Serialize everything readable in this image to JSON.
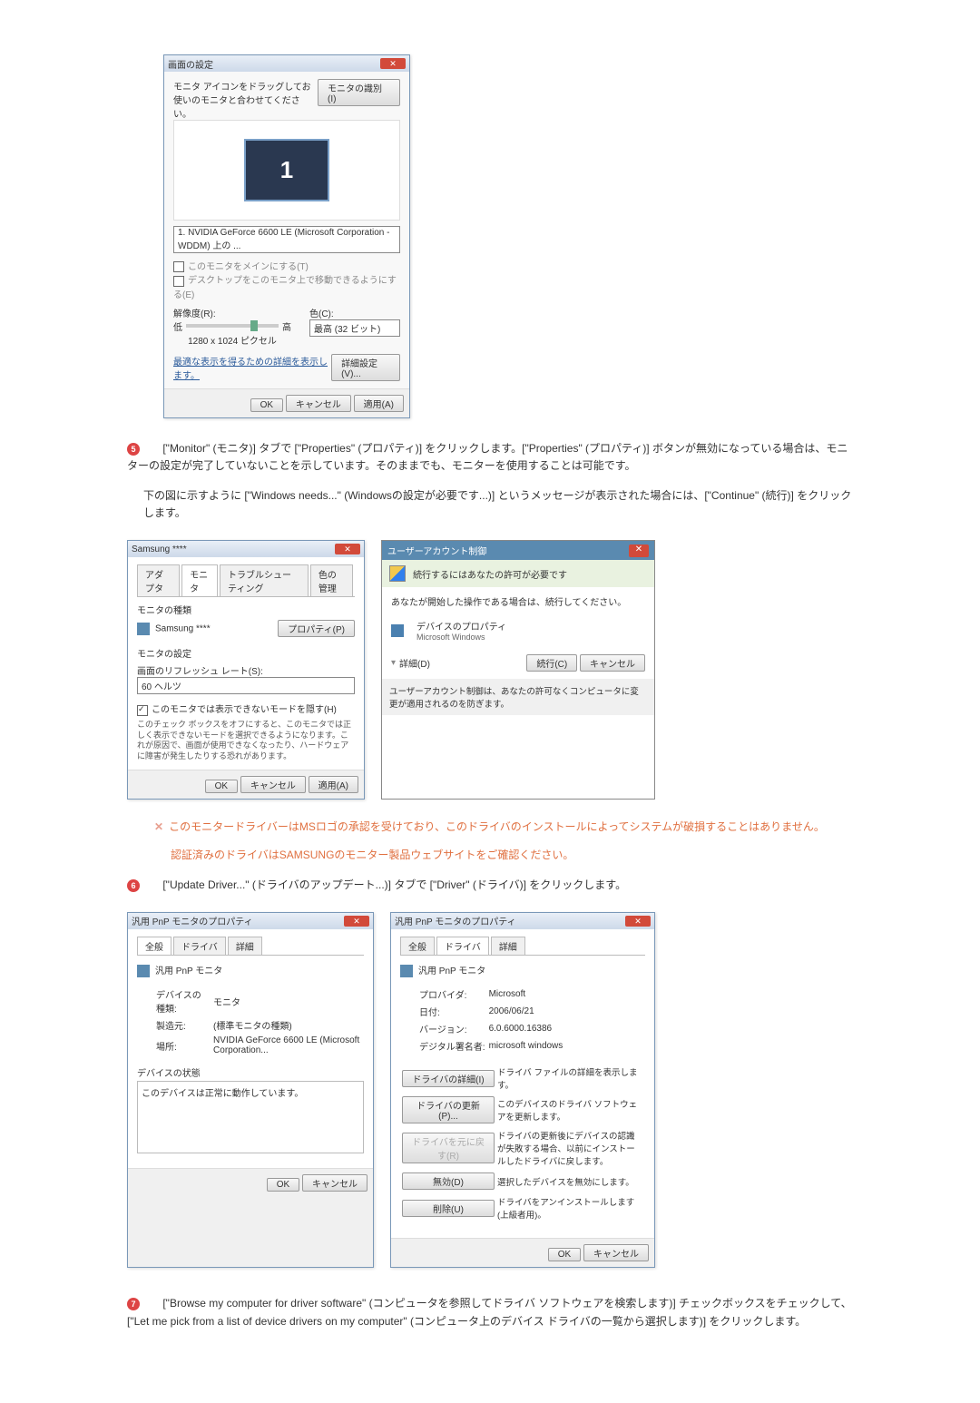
{
  "fig1": {
    "title": "画面の設定",
    "instruction": "モニタ アイコンをドラッグしてお使いのモニタと合わせてください。",
    "identify_btn": "モニタの識別(I)",
    "monitor_num": "1",
    "adapter_combo": "1. NVIDIA GeForce 6600 LE (Microsoft Corporation - WDDM) 上の ...",
    "chk_primary": "このモニタをメインにする(T)",
    "chk_extend": "デスクトップをこのモニタ上で移動できるようにする(E)",
    "resolution_label": "解像度(R):",
    "color_label": "色(C):",
    "slider_low": "低",
    "slider_high": "高",
    "resolution_value": "1280 x 1024 ピクセル",
    "color_combo": "最高 (32 ビット)",
    "adv_link": "最適な表示を得るための詳細を表示します。",
    "adv_btn": "詳細設定(V)...",
    "ok": "OK",
    "cancel": "キャンセル",
    "apply": "適用(A)"
  },
  "step5": {
    "num": "5",
    "text": "[\"Monitor\" (モニタ)] タブで [\"Properties\" (プロパティ)] をクリックします。[\"Properties\" (プロパティ)] ボタンが無効になっている場合は、モニターの設定が完了していないことを示しています。そのままでも、モニターを使用することは可能です。",
    "text2": "下の図に示すように [\"Windows needs...\" (Windowsの設定が必要です...)] というメッセージが表示された場合には、[\"Continue\" (続行)] をクリックします。"
  },
  "fig2a": {
    "title": "Samsung ****",
    "tab_adapter": "アダプタ",
    "tab_monitor": "モニタ",
    "tab_trouble": "トラブルシューティング",
    "tab_color": "色の管理",
    "group_monitor": "モニタの種類",
    "monitor_name": "Samsung ****",
    "prop_btn": "プロパティ(P)",
    "group_settings": "モニタの設定",
    "refresh_label": "画面のリフレッシュ レート(S):",
    "refresh_value": "60 ヘルツ",
    "hide_chk": "このモニタでは表示できないモードを隠す(H)",
    "hide_desc": "このチェック ボックスをオフにすると、このモニタでは正しく表示できないモードを選択できるようになります。これが原因で、画面が使用できなくなったり、ハードウェアに障害が発生したりする恐れがあります。",
    "ok": "OK",
    "cancel": "キャンセル",
    "apply": "適用(A)"
  },
  "fig2b": {
    "title": "ユーザーアカウント制御",
    "banner": "続行するにはあなたの許可が必要です",
    "line1": "あなたが開始した操作である場合は、続行してください。",
    "prop_title": "デバイスのプロパティ",
    "prop_sub": "Microsoft Windows",
    "details": "詳細(D)",
    "continue": "続行(C)",
    "cancel": "キャンセル",
    "footer": "ユーザーアカウント制御は、あなたの許可なくコンピュータに変更が適用されるのを防ぎます。"
  },
  "note": {
    "x": "✕",
    "line1": "このモニタードライバーはMSロゴの承認を受けており、このドライバのインストールによってシステムが破損することはありません。",
    "line2": "認証済みのドライバはSAMSUNGのモニター製品ウェブサイトをご確認ください。"
  },
  "step6": {
    "num": "6",
    "text": "[\"Update Driver...\" (ドライバのアップデート...)] タブで [\"Driver\" (ドライバ)] をクリックします。"
  },
  "fig3a": {
    "title": "汎用 PnP モニタのプロパティ",
    "tab_general": "全般",
    "tab_driver": "ドライバ",
    "tab_detail": "詳細",
    "header": "汎用 PnP モニタ",
    "k_type": "デバイスの種類:",
    "v_type": "モニタ",
    "k_mfr": "製造元:",
    "v_mfr": "(標準モニタの種類)",
    "k_loc": "場所:",
    "v_loc": "NVIDIA GeForce 6600 LE (Microsoft Corporation...",
    "status_label": "デバイスの状態",
    "status_text": "このデバイスは正常に動作しています。",
    "ok": "OK",
    "cancel": "キャンセル"
  },
  "fig3b": {
    "title": "汎用 PnP モニタのプロパティ",
    "tab_general": "全般",
    "tab_driver": "ドライバ",
    "tab_detail": "詳細",
    "header": "汎用 PnP モニタ",
    "k_provider": "プロバイダ:",
    "v_provider": "Microsoft",
    "k_date": "日付:",
    "v_date": "2006/06/21",
    "k_version": "バージョン:",
    "v_version": "6.0.6000.16386",
    "k_signer": "デジタル署名者:",
    "v_signer": "microsoft windows",
    "btn_details": "ドライバの詳細(I)",
    "desc_details": "ドライバ ファイルの詳細を表示します。",
    "btn_update": "ドライバの更新(P)...",
    "desc_update": "このデバイスのドライバ ソフトウェアを更新します。",
    "btn_rollback": "ドライバを元に戻す(R)",
    "desc_rollback": "ドライバの更新後にデバイスの認識が失敗する場合、以前にインストールしたドライバに戻します。",
    "btn_disable": "無効(D)",
    "desc_disable": "選択したデバイスを無効にします。",
    "btn_uninstall": "削除(U)",
    "desc_uninstall": "ドライバをアンインストールします (上級者用)。",
    "ok": "OK",
    "cancel": "キャンセル"
  },
  "step7": {
    "num": "7",
    "text": "[\"Browse my computer for driver software\" (コンピュータを参照してドライバ ソフトウェアを検索します)] チェックボックスをチェックして、[\"Let me pick from a list of device drivers on my computer\" (コンピュータ上のデバイス ドライバの一覧から選択します)] をクリックします。"
  }
}
